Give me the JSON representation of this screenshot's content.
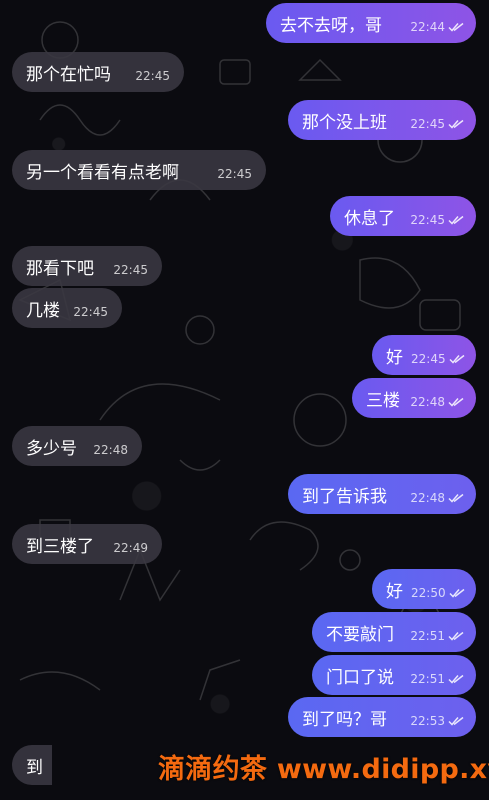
{
  "messages": [
    {
      "dir": "out",
      "text": "去不去呀，哥",
      "time": "22:44",
      "read": true
    },
    {
      "dir": "in",
      "text": "那个在忙吗",
      "time": "22:45"
    },
    {
      "dir": "out",
      "text": "那个没上班",
      "time": "22:45",
      "read": true
    },
    {
      "dir": "in",
      "text": "另一个看看有点老啊",
      "time": "22:45"
    },
    {
      "dir": "out",
      "text": "休息了",
      "time": "22:45",
      "read": true
    },
    {
      "dir": "in",
      "text": "那看下吧",
      "time": "22:45"
    },
    {
      "dir": "in",
      "text": "几楼",
      "time": "22:45"
    },
    {
      "dir": "out",
      "text": "好",
      "time": "22:45",
      "read": true
    },
    {
      "dir": "out",
      "text": "三楼",
      "time": "22:48",
      "read": true
    },
    {
      "dir": "in",
      "text": "多少号",
      "time": "22:48"
    },
    {
      "dir": "out",
      "text": "到了告诉我",
      "time": "22:48",
      "read": true
    },
    {
      "dir": "in",
      "text": "到三楼了",
      "time": "22:49"
    },
    {
      "dir": "out",
      "text": "好",
      "time": "22:50",
      "read": true
    },
    {
      "dir": "out",
      "text": "不要敲门",
      "time": "22:51",
      "read": true
    },
    {
      "dir": "out",
      "text": "门口了说",
      "time": "22:51",
      "read": true
    },
    {
      "dir": "out",
      "text": "到了吗？哥",
      "time": "22:53",
      "read": true
    },
    {
      "dir": "in",
      "text": "到",
      "time": ""
    }
  ],
  "watermark": "滴滴约茶 www.didipp.xyz",
  "colors": {
    "incoming_bubble": "#3a3842",
    "outgoing_bubble_start": "#6a5af0",
    "outgoing_bubble_end": "#8e54e6",
    "watermark": "#f46a10"
  },
  "icons": {
    "read_receipt": "double-check-icon"
  }
}
